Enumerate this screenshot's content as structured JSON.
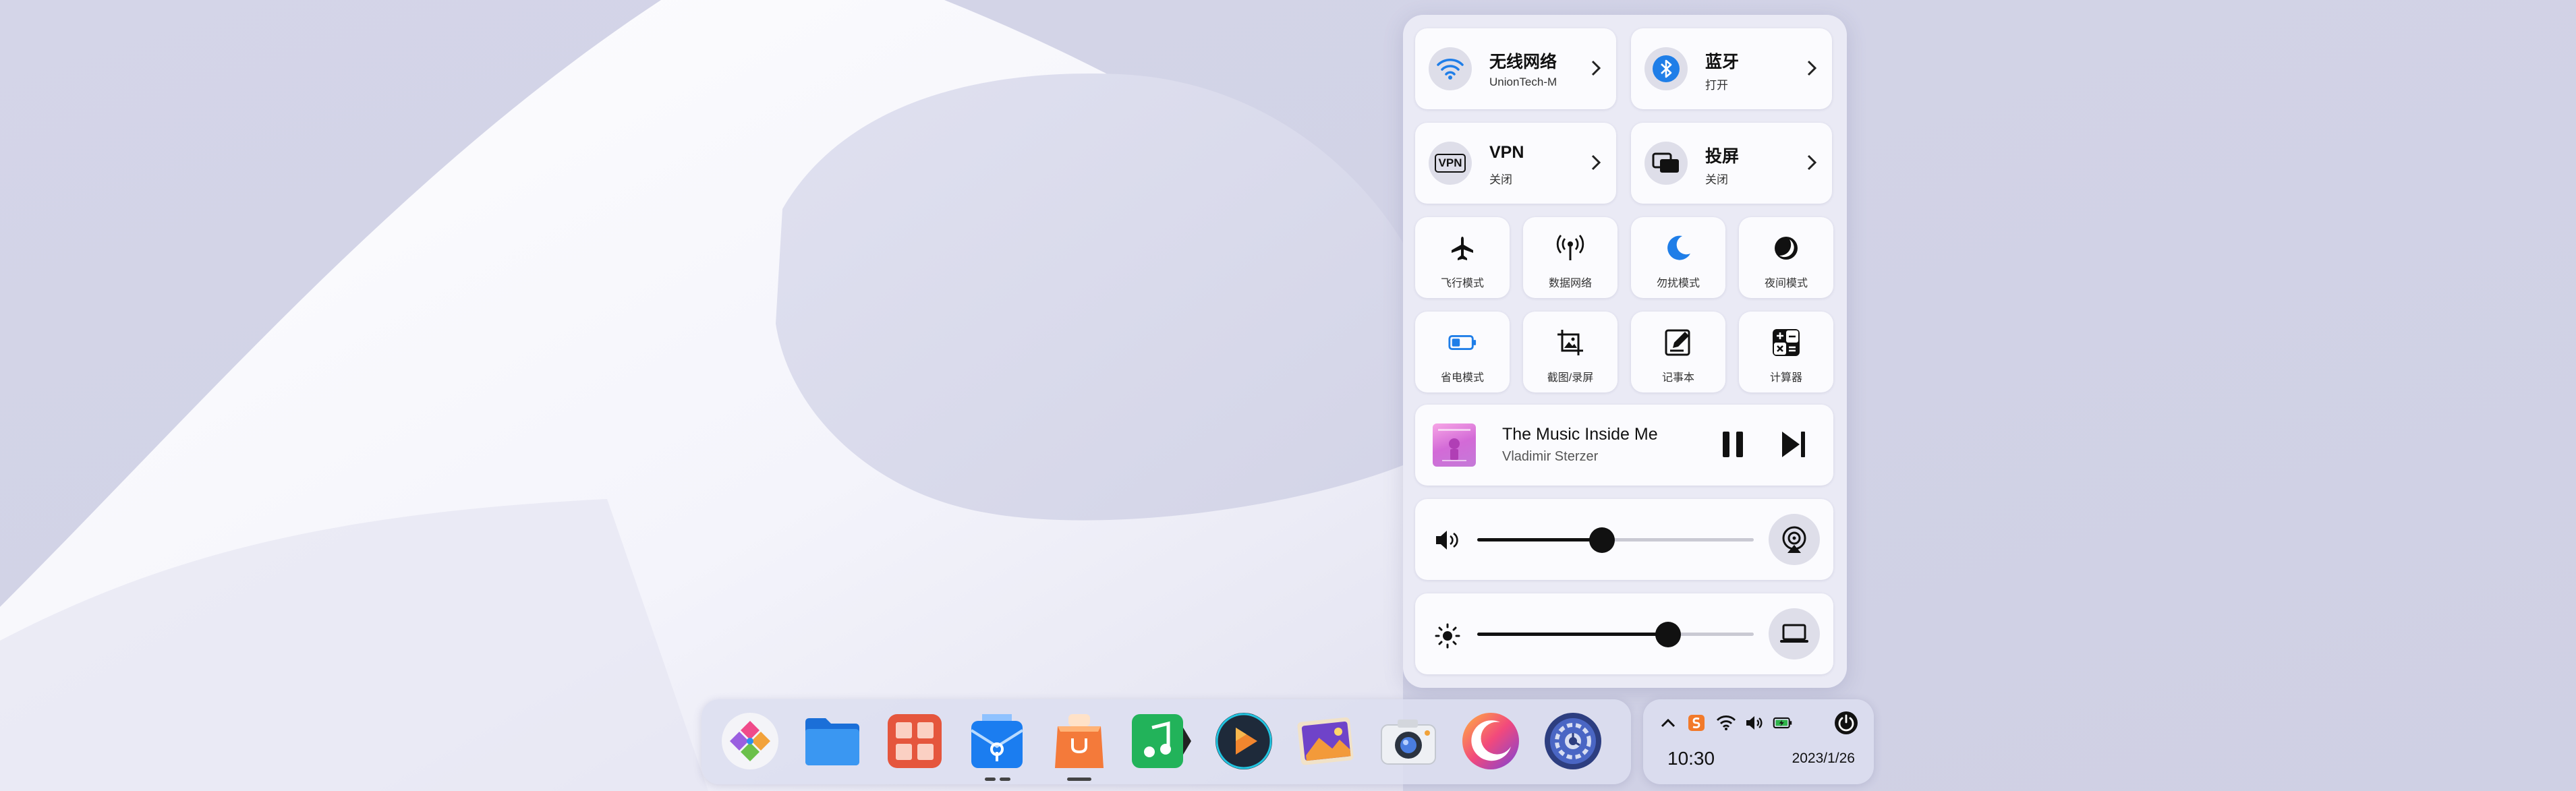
{
  "control_center": {
    "wifi": {
      "title": "无线网络",
      "status": "UnionTech-M"
    },
    "bluetooth": {
      "title": "蓝牙",
      "status": "打开"
    },
    "vpn": {
      "title": "VPN",
      "status": "关闭",
      "icon_text": "VPN"
    },
    "cast": {
      "title": "投屏",
      "status": "关闭"
    },
    "toggles": [
      {
        "label": "飞行模式",
        "icon": "airplane-icon"
      },
      {
        "label": "数据网络",
        "icon": "cellular-antenna-icon"
      },
      {
        "label": "勿扰模式",
        "icon": "moon-icon"
      },
      {
        "label": "夜间模式",
        "icon": "night-mode-icon"
      },
      {
        "label": "省电模式",
        "icon": "battery-icon"
      },
      {
        "label": "截图/录屏",
        "icon": "screenshot-icon"
      },
      {
        "label": "记事本",
        "icon": "notepad-icon"
      },
      {
        "label": "计算器",
        "icon": "calculator-icon"
      }
    ],
    "media": {
      "song": "The Music Inside Me",
      "artist": "Vladimir Sterzer"
    },
    "volume": {
      "level": 0.45
    },
    "brightness": {
      "level": 0.69
    },
    "accent_color": "#1f7ee8"
  },
  "dock": {
    "apps": [
      "launcher-icon",
      "file-manager-icon",
      "app-store-icon",
      "mail-icon",
      "store-bag-icon",
      "music-icon",
      "video-player-icon",
      "image-viewer-icon",
      "camera-icon",
      "browser-icon",
      "settings-icon"
    ]
  },
  "tray": {
    "time": "10:30",
    "date": "2023/1/26"
  }
}
